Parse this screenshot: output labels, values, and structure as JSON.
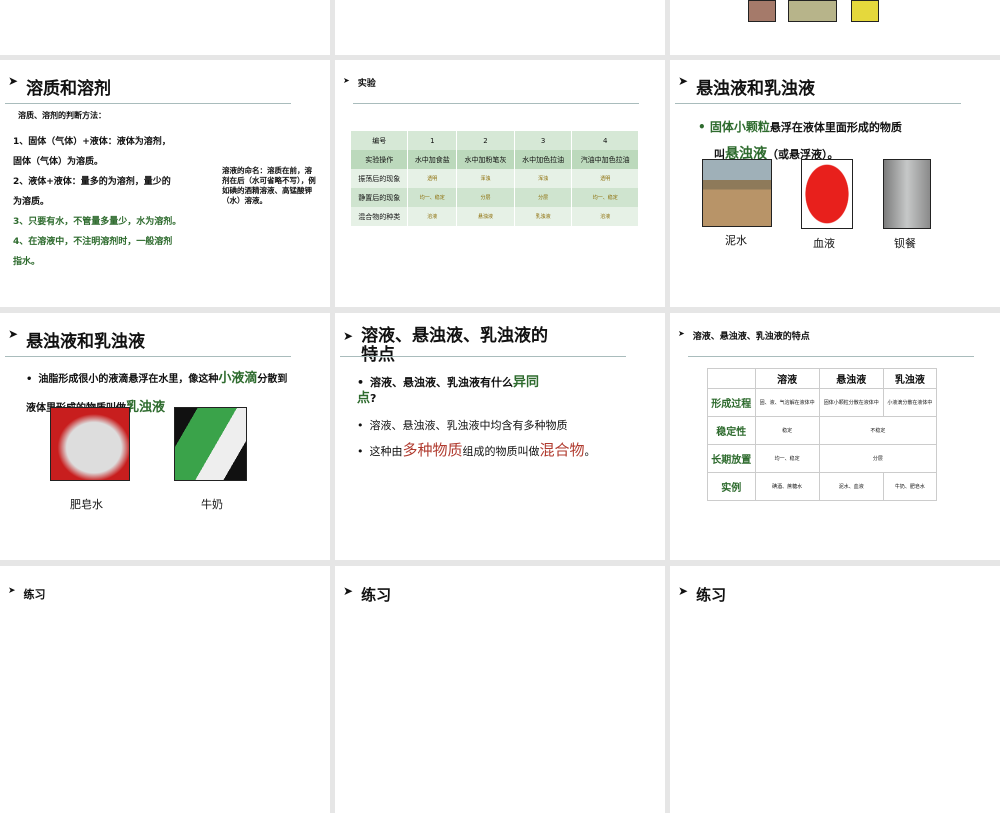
{
  "slides": {
    "s3": {
      "title": "溶质和溶剂",
      "subtitle": "溶质、溶剂的判断方法：",
      "lines": [
        "1、固体（气体）+液体：液体为溶剂，",
        "固体（气体）为溶质。",
        "2、液体+液体：量多的为溶剂，量少的",
        "为溶质。",
        "3、只要有水，不管量多量少，水为溶剂。",
        "4、在溶液中，不注明溶剂时，一般溶剂",
        "指水。"
      ],
      "note": "溶液的命名：溶质在前，溶剂在后（水可省略不写），例如碘的酒精溶液、高锰酸钾（水）溶液。"
    },
    "s4": {
      "title": "实验",
      "headers": [
        "编号",
        "1",
        "2",
        "3",
        "4"
      ],
      "rows": [
        [
          "实验操作",
          "水中加食盐",
          "水中加粉笔灰",
          "水中加色拉油",
          "汽油中加色拉油"
        ],
        [
          "振荡后的现象",
          "透明",
          "浑浊",
          "浑浊",
          "透明"
        ],
        [
          "静置后的现象",
          "均一、稳定",
          "分层",
          "分层",
          "均一、稳定"
        ],
        [
          "混合物的种类",
          "溶液",
          "悬浊液",
          "乳浊液",
          "溶液"
        ]
      ]
    },
    "s5": {
      "title": "悬浊液和乳浊液",
      "text_a": "固体小颗粒",
      "text_b": "悬浮在液体里面形成的物质",
      "text_c": "叫",
      "text_d": "悬浊液",
      "text_e": "（或悬浮液）。",
      "captions": [
        "泥水",
        "血液",
        "钡餐"
      ]
    },
    "s6": {
      "title": "悬浊液和乳浊液",
      "text_a": "油脂形成很小的液滴悬浮在水里，像这种",
      "text_b": "小液滴",
      "text_c": "分散到液体里形成的物质叫做",
      "text_d": "乳浊液",
      "captions": [
        "肥皂水",
        "牛奶"
      ]
    },
    "s7": {
      "title": "溶液、悬浊液、乳浊液的特点",
      "b1a": "溶液、悬浊液、乳浊液有什么",
      "b1b": "异同点",
      "b1c": "?",
      "b2": "溶液、悬浊液、乳浊液中均含有多种物质",
      "b3a": "这种由",
      "b3b": "多种物质",
      "b3c": "组成的物质叫做",
      "b3d": "混合物",
      "b3e": "。"
    },
    "s8": {
      "title": "溶液、悬浊液、乳浊液的特点",
      "headers": [
        "",
        "溶液",
        "悬浊液",
        "乳浊液"
      ],
      "r1": [
        "形成过程",
        "固、液、气溶解在液体中",
        "固体小颗粒分散在液体中",
        "小液滴分散在液体中"
      ],
      "r2": [
        "稳定性",
        "稳定",
        "不稳定"
      ],
      "r3": [
        "长期放置",
        "均一、稳定",
        "分层"
      ],
      "r4": [
        "实例",
        "碘酒、蔗糖水",
        "泥水、血液",
        "牛奶、肥皂水"
      ]
    },
    "s9": {
      "title": "练习"
    },
    "s10": {
      "title": "练习"
    },
    "s11": {
      "title": "练习"
    }
  }
}
